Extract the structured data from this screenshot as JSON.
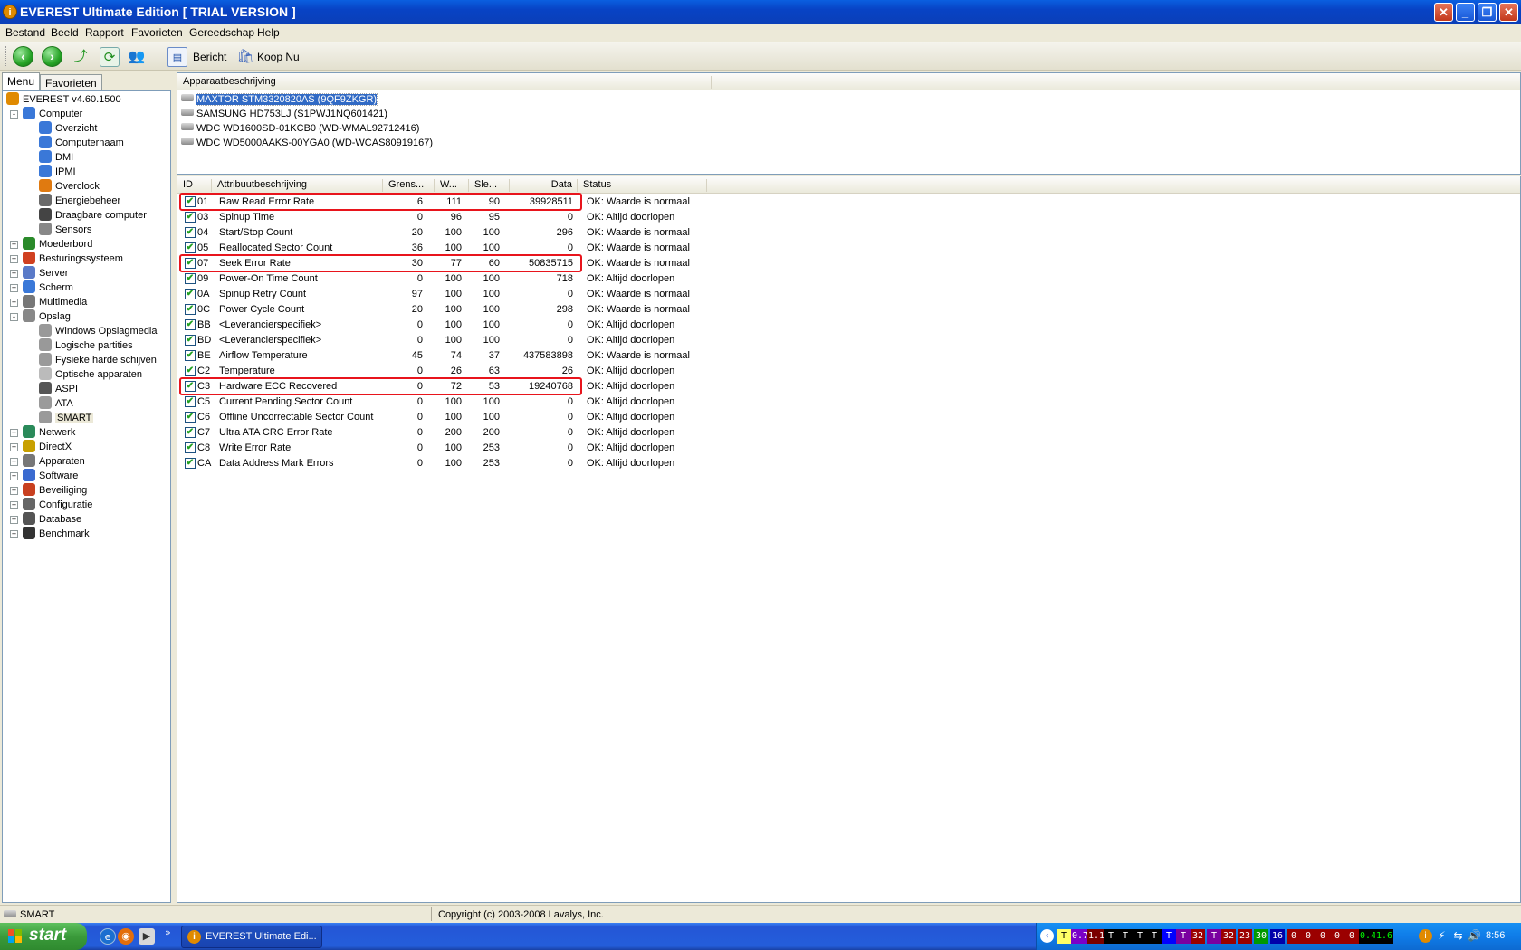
{
  "window": {
    "title": "EVEREST Ultimate Edition  [ TRIAL VERSION ]",
    "controls": [
      "close",
      "minimize",
      "restore",
      "close"
    ]
  },
  "menu": [
    "Bestand",
    "Beeld",
    "Rapport",
    "Favorieten",
    "Gereedschap",
    "Help"
  ],
  "toolbar": {
    "buttons": [
      "back-icon",
      "forward-icon",
      "up-icon",
      "refresh-icon",
      "users-icon"
    ],
    "report_label": "Bericht",
    "buy_label": "Koop Nu"
  },
  "left_tabs": [
    "Menu",
    "Favorieten"
  ],
  "tree": [
    {
      "label": "EVEREST v4.60.1500",
      "level": 0,
      "icon": "info-icon"
    },
    {
      "label": "Computer",
      "level": 1,
      "icon": "computer-icon",
      "expander": "-"
    },
    {
      "label": "Overzicht",
      "level": 2,
      "icon": "computer-icon"
    },
    {
      "label": "Computernaam",
      "level": 2,
      "icon": "computer-icon"
    },
    {
      "label": "DMI",
      "level": 2,
      "icon": "computer-icon"
    },
    {
      "label": "IPMI",
      "level": 2,
      "icon": "computer-icon"
    },
    {
      "label": "Overclock",
      "level": 2,
      "icon": "flame-icon"
    },
    {
      "label": "Energiebeheer",
      "level": 2,
      "icon": "power-icon"
    },
    {
      "label": "Draagbare computer",
      "level": 2,
      "icon": "laptop-icon"
    },
    {
      "label": "Sensors",
      "level": 2,
      "icon": "sensor-icon"
    },
    {
      "label": "Moederbord",
      "level": 1,
      "icon": "motherboard-icon",
      "expander": "+"
    },
    {
      "label": "Besturingssysteem",
      "level": 1,
      "icon": "windows-icon",
      "expander": "+"
    },
    {
      "label": "Server",
      "level": 1,
      "icon": "server-icon",
      "expander": "+"
    },
    {
      "label": "Scherm",
      "level": 1,
      "icon": "monitor-icon",
      "expander": "+"
    },
    {
      "label": "Multimedia",
      "level": 1,
      "icon": "speaker-icon",
      "expander": "+"
    },
    {
      "label": "Opslag",
      "level": 1,
      "icon": "storage-icon",
      "expander": "-"
    },
    {
      "label": "Windows Opslagmedia",
      "level": 2,
      "icon": "disk-icon"
    },
    {
      "label": "Logische partities",
      "level": 2,
      "icon": "partition-icon"
    },
    {
      "label": "Fysieke harde schijven",
      "level": 2,
      "icon": "harddisk-icon"
    },
    {
      "label": "Optische apparaten",
      "level": 2,
      "icon": "cd-icon"
    },
    {
      "label": "ASPI",
      "level": 2,
      "icon": "aspi-icon"
    },
    {
      "label": "ATA",
      "level": 2,
      "icon": "harddisk-icon"
    },
    {
      "label": "SMART",
      "level": 2,
      "icon": "harddisk-icon",
      "selected": true
    },
    {
      "label": "Netwerk",
      "level": 1,
      "icon": "network-icon",
      "expander": "+"
    },
    {
      "label": "DirectX",
      "level": 1,
      "icon": "directx-icon",
      "expander": "+"
    },
    {
      "label": "Apparaten",
      "level": 1,
      "icon": "devices-icon",
      "expander": "+"
    },
    {
      "label": "Software",
      "level": 1,
      "icon": "software-icon",
      "expander": "+"
    },
    {
      "label": "Beveiliging",
      "level": 1,
      "icon": "shield-icon",
      "expander": "+"
    },
    {
      "label": "Configuratie",
      "level": 1,
      "icon": "config-icon",
      "expander": "+"
    },
    {
      "label": "Database",
      "level": 1,
      "icon": "database-icon",
      "expander": "+"
    },
    {
      "label": "Benchmark",
      "level": 1,
      "icon": "hourglass-icon",
      "expander": "+"
    }
  ],
  "device_pane": {
    "header": "Apparaatbeschrijving",
    "devices": [
      {
        "label": "MAXTOR STM3320820AS (9QF9ZKGR)",
        "selected": true
      },
      {
        "label": "SAMSUNG HD753LJ (S1PWJ1NQ601421)"
      },
      {
        "label": "WDC WD1600SD-01KCB0 (WD-WMAL92712416)"
      },
      {
        "label": "WDC WD5000AAKS-00YGA0 (WD-WCAS80919167)"
      }
    ]
  },
  "attr_pane": {
    "headers": [
      "ID",
      "Attribuutbeschrijving",
      "Grens...",
      "W...",
      "Sle...",
      "Data",
      "Status"
    ],
    "rows": [
      {
        "id": "01",
        "name": "Raw Read Error Rate",
        "threshold": "6",
        "value": "111",
        "worst": "90",
        "data": "39928511",
        "status": "OK: Waarde is normaal",
        "highlight": true
      },
      {
        "id": "03",
        "name": "Spinup Time",
        "threshold": "0",
        "value": "96",
        "worst": "95",
        "data": "0",
        "status": "OK: Altijd doorlopen"
      },
      {
        "id": "04",
        "name": "Start/Stop Count",
        "threshold": "20",
        "value": "100",
        "worst": "100",
        "data": "296",
        "status": "OK: Waarde is normaal"
      },
      {
        "id": "05",
        "name": "Reallocated Sector Count",
        "threshold": "36",
        "value": "100",
        "worst": "100",
        "data": "0",
        "status": "OK: Waarde is normaal"
      },
      {
        "id": "07",
        "name": "Seek Error Rate",
        "threshold": "30",
        "value": "77",
        "worst": "60",
        "data": "50835715",
        "status": "OK: Waarde is normaal",
        "highlight": true
      },
      {
        "id": "09",
        "name": "Power-On Time Count",
        "threshold": "0",
        "value": "100",
        "worst": "100",
        "data": "718",
        "status": "OK: Altijd doorlopen"
      },
      {
        "id": "0A",
        "name": "Spinup Retry Count",
        "threshold": "97",
        "value": "100",
        "worst": "100",
        "data": "0",
        "status": "OK: Waarde is normaal"
      },
      {
        "id": "0C",
        "name": "Power Cycle Count",
        "threshold": "20",
        "value": "100",
        "worst": "100",
        "data": "298",
        "status": "OK: Waarde is normaal"
      },
      {
        "id": "BB",
        "name": "<Leverancierspecifiek>",
        "threshold": "0",
        "value": "100",
        "worst": "100",
        "data": "0",
        "status": "OK: Altijd doorlopen"
      },
      {
        "id": "BD",
        "name": "<Leverancierspecifiek>",
        "threshold": "0",
        "value": "100",
        "worst": "100",
        "data": "0",
        "status": "OK: Altijd doorlopen"
      },
      {
        "id": "BE",
        "name": "Airflow Temperature",
        "threshold": "45",
        "value": "74",
        "worst": "37",
        "data": "437583898",
        "status": "OK: Waarde is normaal"
      },
      {
        "id": "C2",
        "name": "Temperature",
        "threshold": "0",
        "value": "26",
        "worst": "63",
        "data": "26",
        "status": "OK: Altijd doorlopen"
      },
      {
        "id": "C3",
        "name": "Hardware ECC Recovered",
        "threshold": "0",
        "value": "72",
        "worst": "53",
        "data": "19240768",
        "status": "OK: Altijd doorlopen",
        "highlight": true
      },
      {
        "id": "C5",
        "name": "Current Pending Sector Count",
        "threshold": "0",
        "value": "100",
        "worst": "100",
        "data": "0",
        "status": "OK: Altijd doorlopen"
      },
      {
        "id": "C6",
        "name": "Offline Uncorrectable Sector Count",
        "threshold": "0",
        "value": "100",
        "worst": "100",
        "data": "0",
        "status": "OK: Altijd doorlopen"
      },
      {
        "id": "C7",
        "name": "Ultra ATA CRC Error Rate",
        "threshold": "0",
        "value": "200",
        "worst": "200",
        "data": "0",
        "status": "OK: Altijd doorlopen"
      },
      {
        "id": "C8",
        "name": "Write Error Rate",
        "threshold": "0",
        "value": "100",
        "worst": "253",
        "data": "0",
        "status": "OK: Altijd doorlopen"
      },
      {
        "id": "CA",
        "name": "Data Address Mark Errors",
        "threshold": "0",
        "value": "100",
        "worst": "253",
        "data": "0",
        "status": "OK: Altijd doorlopen"
      }
    ]
  },
  "statusbar": {
    "left": "SMART",
    "right": "Copyright (c) 2003-2008 Lavalys, Inc."
  },
  "taskbar": {
    "start_label": "start",
    "task_label": "EVEREST Ultimate Edi...",
    "tray_items": [
      {
        "text": "T",
        "bg": "#ffff66",
        "fg": "#000"
      },
      {
        "text": "0.7",
        "bg": "#7a00c8",
        "fg": "#fff"
      },
      {
        "text": "1.1",
        "bg": "#7a0000",
        "fg": "#fff"
      },
      {
        "text": "T",
        "bg": "#000000",
        "fg": "#fff"
      },
      {
        "text": "T",
        "bg": "#000000",
        "fg": "#fff"
      },
      {
        "text": "T",
        "bg": "#000000",
        "fg": "#fff"
      },
      {
        "text": "T",
        "bg": "#000000",
        "fg": "#fff"
      },
      {
        "text": "T",
        "bg": "#0000ff",
        "fg": "#fff"
      },
      {
        "text": "T",
        "bg": "#7a00a0",
        "fg": "#fff"
      },
      {
        "text": "32",
        "bg": "#9b0000",
        "fg": "#fff"
      },
      {
        "text": "T",
        "bg": "#7a00a0",
        "fg": "#fff"
      },
      {
        "text": "32",
        "bg": "#9b0000",
        "fg": "#fff"
      },
      {
        "text": "23",
        "bg": "#9b0000",
        "fg": "#fff"
      },
      {
        "text": "30",
        "bg": "#009900",
        "fg": "#fff"
      },
      {
        "text": "16",
        "bg": "#0000aa",
        "fg": "#fff"
      },
      {
        "text": "0",
        "bg": "#9b0000",
        "fg": "#fff"
      },
      {
        "text": "0",
        "bg": "#9b0000",
        "fg": "#fff"
      },
      {
        "text": "0",
        "bg": "#9b0000",
        "fg": "#fff"
      },
      {
        "text": "0",
        "bg": "#9b0000",
        "fg": "#fff"
      },
      {
        "text": "0",
        "bg": "#9b0000",
        "fg": "#fff"
      },
      {
        "text": "0.4",
        "bg": "#000000",
        "fg": "#0f0"
      },
      {
        "text": "1.6",
        "bg": "#000000",
        "fg": "#0f0"
      }
    ],
    "clock": "8:56"
  }
}
